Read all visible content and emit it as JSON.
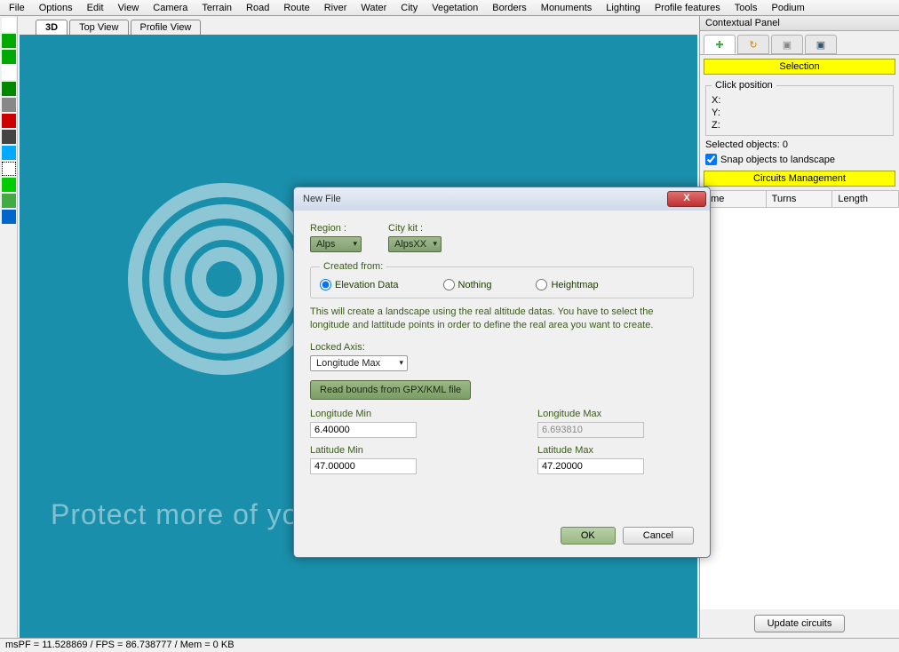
{
  "menu": [
    "File",
    "Options",
    "Edit",
    "View",
    "Camera",
    "Terrain",
    "Road",
    "Route",
    "River",
    "Water",
    "City",
    "Vegetation",
    "Borders",
    "Monuments",
    "Lighting",
    "Profile features",
    "Tools",
    "Podium"
  ],
  "tabs": {
    "d3": "3D",
    "top": "Top View",
    "profile": "Profile View"
  },
  "panel": {
    "title": "Contextual Panel",
    "selection": "Selection",
    "click_pos": "Click position",
    "x": "X:",
    "y": "Y:",
    "z": "Z:",
    "selected": "Selected objects:  0",
    "snap": "Snap objects to landscape",
    "circuits": "Circuits Management",
    "col_name": "ame",
    "col_turns": "Turns",
    "col_len": "Length",
    "update": "Update circuits"
  },
  "dialog": {
    "title": "New File",
    "region_l": "Region :",
    "region_v": "Alps",
    "citykit_l": "City kit :",
    "citykit_v": "AlpsXX",
    "created_from": "Created from:",
    "r_elev": "Elevation Data",
    "r_nothing": "Nothing",
    "r_height": "Heightmap",
    "desc": "This will create a landscape using the real altitude datas. You have to select the longitude and lattitude points in order to define the real area you want to create.",
    "locked_l": "Locked Axis:",
    "locked_v": "Longitude Max",
    "read_btn": "Read bounds from GPX/KML file",
    "lon_min_l": "Longitude Min",
    "lon_min_v": "6.40000",
    "lon_max_l": "Longitude Max",
    "lon_max_v": "6.693810",
    "lat_min_l": "Latitude Min",
    "lat_min_v": "47.00000",
    "lat_max_l": "Latitude Max",
    "lat_max_v": "47.20000",
    "ok": "OK",
    "cancel": "Cancel"
  },
  "watermark": "Protect more of your memories fo",
  "status": "msPF = 11.528869 / FPS = 86.738777 / Mem = 0 KB"
}
